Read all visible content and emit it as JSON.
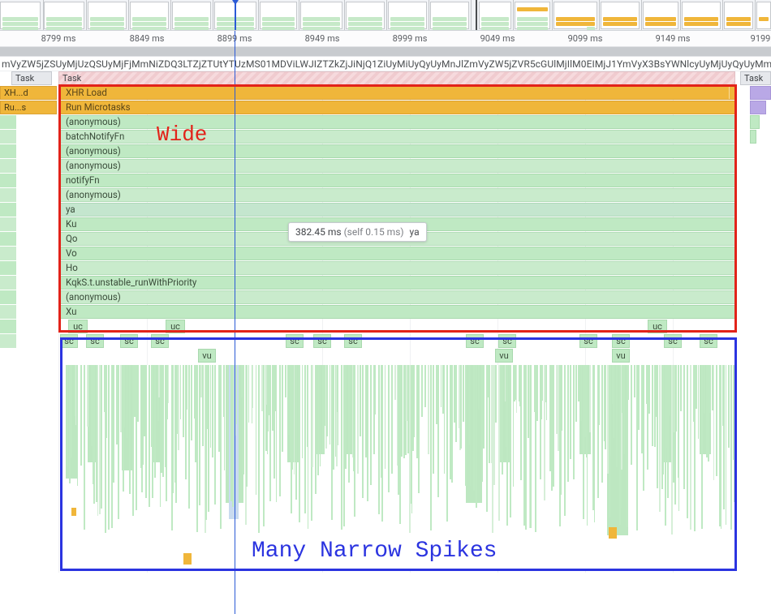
{
  "ruler": {
    "ticks": [
      {
        "pos": 72,
        "label": "8799 ms"
      },
      {
        "pos": 181,
        "label": "8849 ms"
      },
      {
        "pos": 289,
        "label": "8899 ms"
      },
      {
        "pos": 397,
        "label": "8949 ms"
      },
      {
        "pos": 505,
        "label": "8999 ms"
      },
      {
        "pos": 613,
        "label": "9049 ms"
      },
      {
        "pos": 721,
        "label": "9099 ms"
      },
      {
        "pos": 829,
        "label": "9149 ms"
      },
      {
        "pos": 937,
        "label": "9199"
      }
    ]
  },
  "token_strip": "mVyZW5jZSUyMjUzQSUyMjFjMmNiZDQ3LTZjZTUtYTUzMS01MDViLWJIZTZkZjJiNjQ1ZiUyMiUyQyUyMnJlZmVyZW5jZVR5cGUlMjIlM0EIMjJ1YmVyX3BsYWNlcyUyMjUyQyUyMmxh",
  "tasks": {
    "left_short": "Task",
    "main": "Task",
    "right_short": "Task"
  },
  "left_blocks": {
    "xhr": "XH...d",
    "run": "Ru...s"
  },
  "flame_stack": [
    {
      "label": "XHR Load",
      "style": "orange"
    },
    {
      "label": "Run Microtasks",
      "style": "orange"
    },
    {
      "label": "(anonymous)",
      "style": "green"
    },
    {
      "label": "batchNotifyFn",
      "style": "green-alt"
    },
    {
      "label": "(anonymous)",
      "style": "green"
    },
    {
      "label": "(anonymous)",
      "style": "green-alt"
    },
    {
      "label": "notifyFn",
      "style": "green"
    },
    {
      "label": "(anonymous)",
      "style": "green-alt"
    },
    {
      "label": "ya",
      "style": "green-pale"
    },
    {
      "label": "Ku",
      "style": "green"
    },
    {
      "label": "Qo",
      "style": "green-alt"
    },
    {
      "label": "Vo",
      "style": "green"
    },
    {
      "label": "Ho",
      "style": "green-alt"
    },
    {
      "label": "KqkS.t.unstable_runWithPriority",
      "style": "green"
    },
    {
      "label": "(anonymous)",
      "style": "green-alt"
    },
    {
      "label": "Xu",
      "style": "green"
    }
  ],
  "small_rows": {
    "uc": "uc",
    "sc": "sc",
    "vu": "vu"
  },
  "tooltip": {
    "duration": "382.45 ms",
    "self": "(self 0.15 ms)",
    "fn": "ya"
  },
  "annotations": {
    "wide": "Wide",
    "spikes": "Many Narrow Spikes"
  },
  "colors": {
    "cursor": "#2b5ad6",
    "orange": "#f0b63a",
    "green": "#bfe9c3",
    "red_box": "#e2231a",
    "blue_box": "#2b34e0"
  }
}
